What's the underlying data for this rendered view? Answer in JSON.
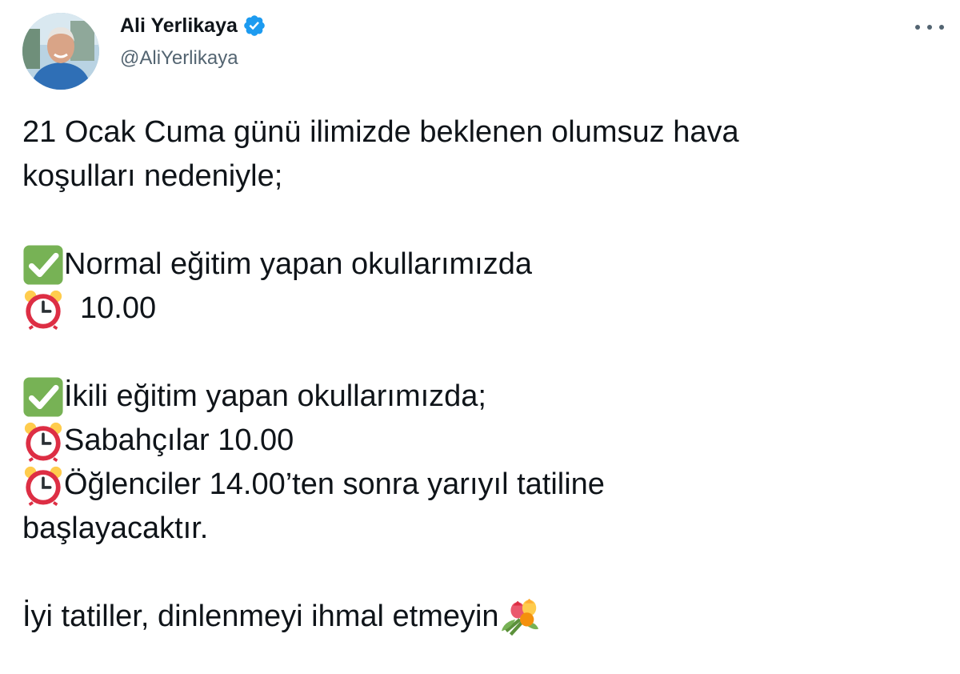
{
  "user": {
    "display_name": "Ali Yerlikaya",
    "handle": "@AliYerlikaya",
    "verified": true
  },
  "tweet": {
    "line1": "21 Ocak Cuma günü ilimizde beklenen olumsuz hava",
    "line2": "koşulları nedeniyle;",
    "line3": "Normal eğitim yapan okullarımızda",
    "line4": "10.00",
    "line5": "İkili eğitim yapan okullarımızda;",
    "line6": "Sabahçılar 10.00",
    "line7": "Öğlenciler 14.00’ten sonra yarıyıl tatiline",
    "line8": "başlayacaktır.",
    "line9": "İyi tatiller, dinlenmeyi ihmal etmeyin"
  },
  "icons": {
    "verified": "verified-badge-icon",
    "check": "check-mark-button-emoji",
    "clock": "alarm-clock-emoji",
    "flowers": "bouquet-emoji",
    "more": "more-options-icon"
  },
  "colors": {
    "text": "#0f1419",
    "secondary": "#536471",
    "verified": "#1d9bf0",
    "check_green": "#77b255",
    "clock_red": "#dd2e44"
  }
}
